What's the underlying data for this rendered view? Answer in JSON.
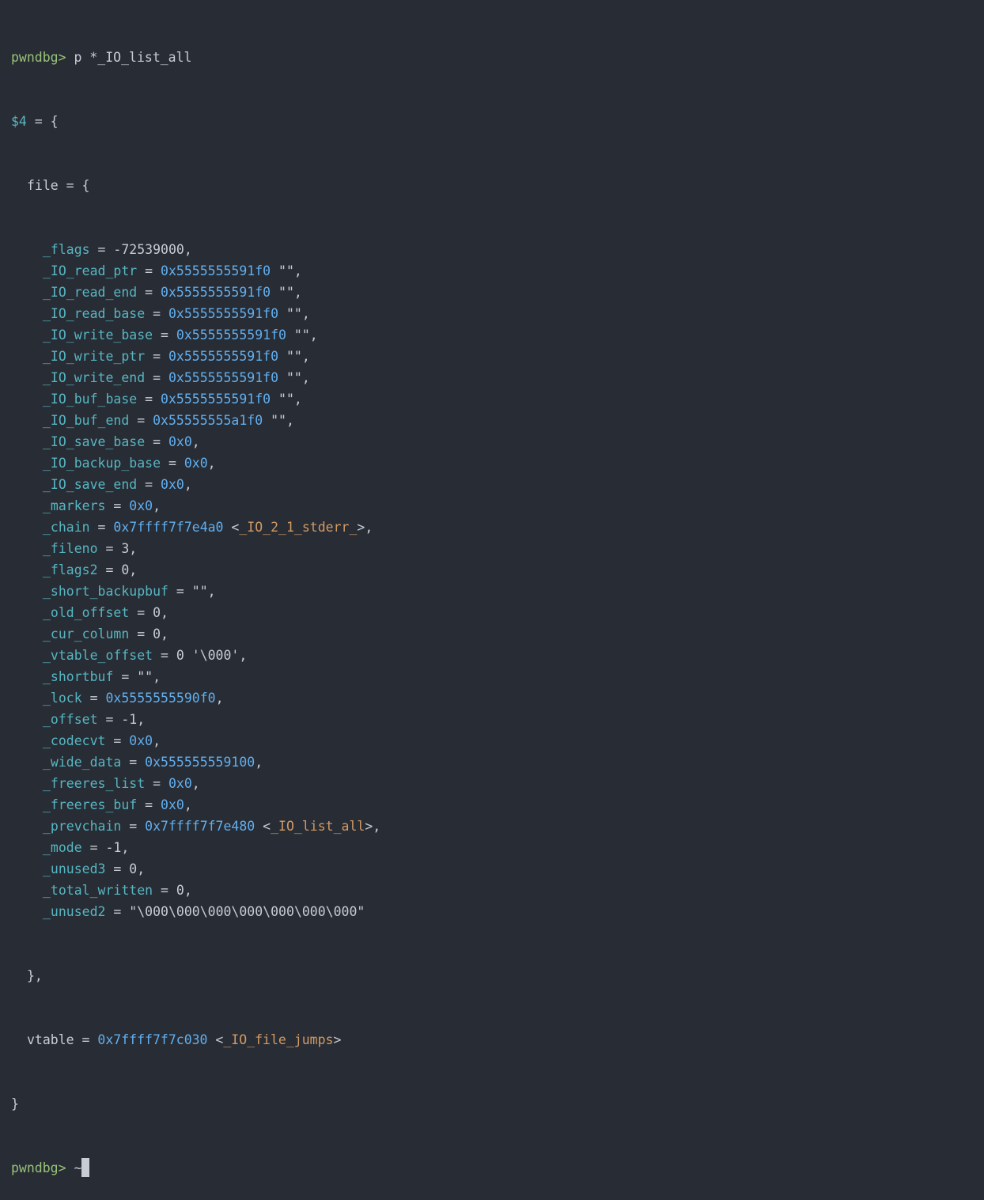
{
  "prompt": "pwndbg>",
  "command": " p *_IO_list_all",
  "result_var": "$4",
  "result_open": " = {",
  "file_open": "file = {",
  "fields": [
    {
      "name": "_flags",
      "value": "-72539000",
      "addr": "",
      "suffix": ","
    },
    {
      "name": "_IO_read_ptr",
      "value": "",
      "addr": "0x5555555591f0",
      "suffix": " \"\","
    },
    {
      "name": "_IO_read_end",
      "value": "",
      "addr": "0x5555555591f0",
      "suffix": " \"\","
    },
    {
      "name": "_IO_read_base",
      "value": "",
      "addr": "0x5555555591f0",
      "suffix": " \"\","
    },
    {
      "name": "_IO_write_base",
      "value": "",
      "addr": "0x5555555591f0",
      "suffix": " \"\","
    },
    {
      "name": "_IO_write_ptr",
      "value": "",
      "addr": "0x5555555591f0",
      "suffix": " \"\","
    },
    {
      "name": "_IO_write_end",
      "value": "",
      "addr": "0x5555555591f0",
      "suffix": " \"\","
    },
    {
      "name": "_IO_buf_base",
      "value": "",
      "addr": "0x5555555591f0",
      "suffix": " \"\","
    },
    {
      "name": "_IO_buf_end",
      "value": "",
      "addr": "0x55555555a1f0",
      "suffix": " \"\","
    },
    {
      "name": "_IO_save_base",
      "value": "",
      "addr": "0x0",
      "suffix": ","
    },
    {
      "name": "_IO_backup_base",
      "value": "",
      "addr": "0x0",
      "suffix": ","
    },
    {
      "name": "_IO_save_end",
      "value": "",
      "addr": "0x0",
      "suffix": ","
    },
    {
      "name": "_markers",
      "value": "",
      "addr": "0x0",
      "suffix": ","
    },
    {
      "name": "_chain",
      "value": "",
      "addr": "0x7ffff7f7e4a0",
      "symbol": "_IO_2_1_stderr_",
      "suffix": ","
    },
    {
      "name": "_fileno",
      "value": "3",
      "addr": "",
      "suffix": ","
    },
    {
      "name": "_flags2",
      "value": "0",
      "addr": "",
      "suffix": ","
    },
    {
      "name": "_short_backupbuf",
      "value": "\"\"",
      "addr": "",
      "suffix": ","
    },
    {
      "name": "_old_offset",
      "value": "0",
      "addr": "",
      "suffix": ","
    },
    {
      "name": "_cur_column",
      "value": "0",
      "addr": "",
      "suffix": ","
    },
    {
      "name": "_vtable_offset",
      "value": "0 '\\000'",
      "addr": "",
      "suffix": ","
    },
    {
      "name": "_shortbuf",
      "value": "\"\"",
      "addr": "",
      "suffix": ","
    },
    {
      "name": "_lock",
      "value": "",
      "addr": "0x5555555590f0",
      "suffix": ","
    },
    {
      "name": "_offset",
      "value": "-1",
      "addr": "",
      "suffix": ","
    },
    {
      "name": "_codecvt",
      "value": "",
      "addr": "0x0",
      "suffix": ","
    },
    {
      "name": "_wide_data",
      "value": "",
      "addr": "0x555555559100",
      "suffix": ","
    },
    {
      "name": "_freeres_list",
      "value": "",
      "addr": "0x0",
      "suffix": ","
    },
    {
      "name": "_freeres_buf",
      "value": "",
      "addr": "0x0",
      "suffix": ","
    },
    {
      "name": "_prevchain",
      "value": "",
      "addr": "0x7ffff7f7e480",
      "symbol": "_IO_list_all",
      "suffix": ","
    },
    {
      "name": "_mode",
      "value": "-1",
      "addr": "",
      "suffix": ","
    },
    {
      "name": "_unused3",
      "value": "0",
      "addr": "",
      "suffix": ","
    },
    {
      "name": "_total_written",
      "value": "0",
      "addr": "",
      "suffix": ","
    },
    {
      "name": "_unused2",
      "value": "\"\\000\\000\\000\\000\\000\\000\\000\"",
      "addr": "",
      "suffix": ""
    }
  ],
  "file_close": "},",
  "vtable": {
    "name": "vtable",
    "addr": "0x7ffff7f7c030",
    "symbol": "_IO_file_jumps"
  },
  "result_close": "}",
  "final_prompt": "pwndbg>",
  "final_input": " ~"
}
